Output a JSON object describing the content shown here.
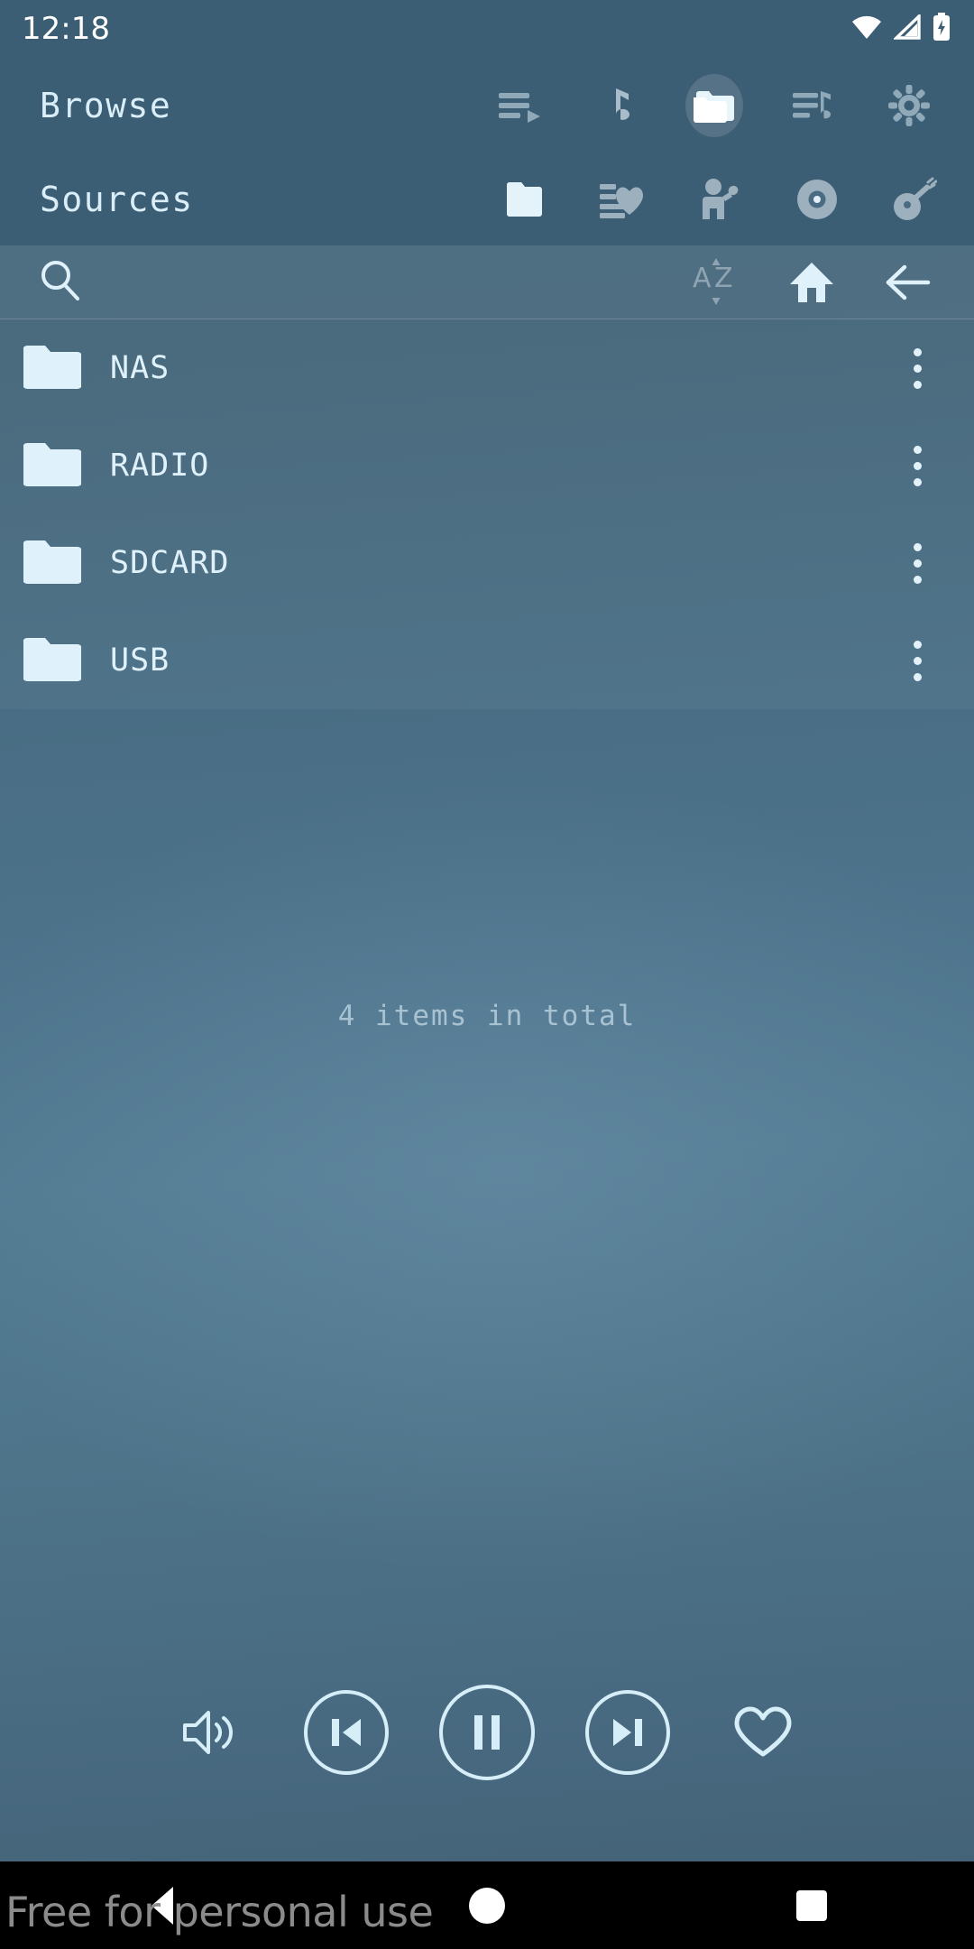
{
  "status_bar": {
    "clock": "12:18",
    "icons": [
      "wifi-icon",
      "cellular-signal-icon",
      "battery-charging-icon"
    ]
  },
  "browse_header": {
    "title": "Browse",
    "icons": [
      {
        "name": "queue-play-icon",
        "label": "Play queue",
        "active": false
      },
      {
        "name": "music-note-icon",
        "label": "Now playing",
        "active": false
      },
      {
        "name": "folder-icon",
        "label": "Browse",
        "active": true
      },
      {
        "name": "playlist-icon",
        "label": "Playlists",
        "active": false
      },
      {
        "name": "gear-icon",
        "label": "Settings",
        "active": false
      }
    ]
  },
  "sources_header": {
    "title": "Sources",
    "icons": [
      {
        "name": "folder-icon",
        "label": "Folders",
        "active": true
      },
      {
        "name": "favorites-list-icon",
        "label": "Favorites",
        "active": false
      },
      {
        "name": "artist-icon",
        "label": "Artists",
        "active": false
      },
      {
        "name": "album-disc-icon",
        "label": "Albums",
        "active": false
      },
      {
        "name": "genre-guitar-icon",
        "label": "Genres",
        "active": false
      }
    ]
  },
  "search_bar": {
    "search_icon": "search-icon",
    "search_placeholder": "Search",
    "search_value": "",
    "actions": [
      {
        "name": "sort-az-icon",
        "label": "Sort A-Z",
        "enabled": false
      },
      {
        "name": "home-icon",
        "label": "Home",
        "enabled": true
      },
      {
        "name": "back-arrow-icon",
        "label": "Back",
        "enabled": true
      }
    ]
  },
  "list": {
    "items": [
      {
        "label": "NAS",
        "icon": "folder-icon",
        "menu": "overflow-menu-icon"
      },
      {
        "label": "RADIO",
        "icon": "folder-icon",
        "menu": "overflow-menu-icon"
      },
      {
        "label": "SDCARD",
        "icon": "folder-icon",
        "menu": "overflow-menu-icon"
      },
      {
        "label": "USB",
        "icon": "folder-icon",
        "menu": "overflow-menu-icon"
      }
    ],
    "total_text": "4 items in total"
  },
  "player": {
    "controls": [
      {
        "name": "volume-icon",
        "label": "Volume",
        "circled": false
      },
      {
        "name": "previous-track-icon",
        "label": "Previous",
        "circled": true
      },
      {
        "name": "pause-icon",
        "label": "Pause",
        "circled": true
      },
      {
        "name": "next-track-icon",
        "label": "Next",
        "circled": true
      },
      {
        "name": "heart-icon",
        "label": "Favorite",
        "circled": false
      }
    ]
  },
  "nav_bar": {
    "buttons": [
      {
        "name": "nav-back-button",
        "label": "Back"
      },
      {
        "name": "nav-home-button",
        "label": "Home"
      },
      {
        "name": "nav-recents-button",
        "label": "Recents"
      }
    ]
  },
  "watermark": {
    "text": "Free for personal use"
  },
  "colors": {
    "app_bg_top": "#3c5e75",
    "app_bg_mid": "#527b92",
    "text_light": "#dff1fa",
    "icon_dim": "#9db0bd",
    "accent": "#d6eef8",
    "nav_bg": "#000000"
  }
}
